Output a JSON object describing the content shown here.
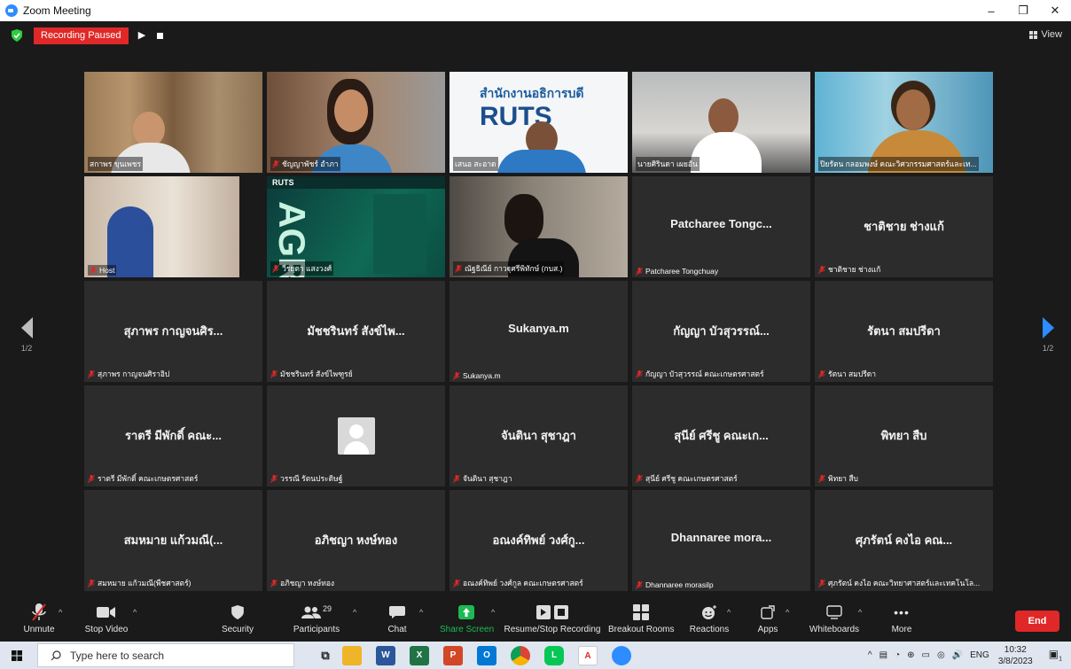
{
  "window": {
    "title": "Zoom Meeting",
    "minimize": "–",
    "restore": "❐",
    "close": "✕"
  },
  "recording": {
    "status": "Recording Paused"
  },
  "view": {
    "label": "View"
  },
  "pager": {
    "left": "1/2",
    "right": "1/2"
  },
  "tiles": [
    {
      "big": "",
      "label": "สกาพร ขุนเพชร",
      "video": "man-office"
    },
    {
      "big": "",
      "label": "ชัญญาพัชร์ อำภา",
      "video": "woman-smile",
      "muted": true
    },
    {
      "big": "",
      "label": "เสนอ สะอาด",
      "video": "ruts-banner",
      "banner_title": "สำนักงานอธิการบดี",
      "banner_logo": "RUTS"
    },
    {
      "big": "",
      "label": "นายศิรินดา เผยอัน",
      "video": "man-desk"
    },
    {
      "big": "",
      "label": "ปิยรัตน กลอมพงษ์ คณะวิศวกรรมศาสตร์และเท...",
      "video": "woman-speaker",
      "active": true
    },
    {
      "big": "",
      "label": "Host",
      "video": "host-blue",
      "muted": true
    },
    {
      "big": "",
      "label": "วีรยุตา แสงวงศ์",
      "video": "agri-screen",
      "muted": true,
      "screen_logo": "RUTS",
      "screen_text": "AGR"
    },
    {
      "big": "",
      "label": "ณัฐธิณีย์ กาวฐุศรีพิทักษ์ (กบส.)",
      "video": "woman-side",
      "muted": true
    },
    {
      "big": "Patcharee Tongc...",
      "label": "Patcharee Tongchuay",
      "muted": true
    },
    {
      "big": "ชาติชาย ช่างแก้",
      "label": "ชาติชาย ช่างแก้",
      "muted": true
    },
    {
      "big": "สุภาพร กาญจนศิร...",
      "label": "สุภาพร กาญจนศิราอิป",
      "muted": true
    },
    {
      "big": "มัชชรินทร์ สังข์ไพ...",
      "label": "มัชชรินทร์ สังข์ไพฑูรย์",
      "muted": true
    },
    {
      "big": "Sukanya.m",
      "label": "Sukanya.m",
      "muted": true
    },
    {
      "big": "กัญญา บัวสุวรรณ์...",
      "label": "กัญญา บัวสุวรรณ์ คณะเกษตรศาสตร์",
      "muted": true
    },
    {
      "big": "รัตนา สมปรีดา",
      "label": "รัตนา สมปรีดา",
      "muted": true
    },
    {
      "big": "ราตรี มีพักดิ์ คณะ...",
      "label": "ราตรี มีพักดิ์ คณะเกษตรศาสตร์",
      "muted": true
    },
    {
      "big": "",
      "label": "วรรณี รัตนประดิษฐ์",
      "muted": true,
      "avatar": true
    },
    {
      "big": "จันตินา สุชาฎา",
      "label": "จันตินา สุชาฎา",
      "muted": true
    },
    {
      "big": "สุนีย์ ศรีชู คณะเก...",
      "label": "สุนีย์ ศรีชู คณะเกษตรศาสตร์",
      "muted": true
    },
    {
      "big": "พิทยา สืบ",
      "label": "พิทยา สืบ",
      "muted": true
    },
    {
      "big": "สมหมาย แก้วมณี(...",
      "label": "สมหมาย แก้วมณี(พืชศาสตร์)",
      "muted": true
    },
    {
      "big": "อภิชญา หงษ์ทอง",
      "label": "อภิชญา หงษ์ทอง",
      "muted": true
    },
    {
      "big": "อณงค์ทิพย์ วงศ์กู...",
      "label": "อณงค์ทิพย์ วงศ์กูล คณะเกษตรศาสตร์",
      "muted": true
    },
    {
      "big": "Dhannaree mora...",
      "label": "Dhannaree morasilp",
      "muted": true
    },
    {
      "big": "ศุภรัตน์ คงไอ คณ...",
      "label": "ศุภรัตน์ คงไอ คณะวิทยาศาสตร์และเทคโนโล...",
      "muted": true
    }
  ],
  "toolbar": {
    "unmute": "Unmute",
    "stop_video": "Stop Video",
    "security": "Security",
    "participants": "Participants",
    "participants_count": "29",
    "chat": "Chat",
    "share_screen": "Share Screen",
    "resume_stop": "Resume/Stop Recording",
    "breakout": "Breakout Rooms",
    "reactions": "Reactions",
    "apps": "Apps",
    "whiteboards": "Whiteboards",
    "more": "More",
    "end": "End"
  },
  "taskbar": {
    "search_placeholder": "Type here to search",
    "lang": "ENG",
    "time": "10:32",
    "date": "3/8/2023",
    "notifications": "1"
  },
  "colors": {
    "accent": "#2d8cff",
    "end": "#e02828",
    "share": "#1db954",
    "active_speaker": "#e8e23a"
  }
}
